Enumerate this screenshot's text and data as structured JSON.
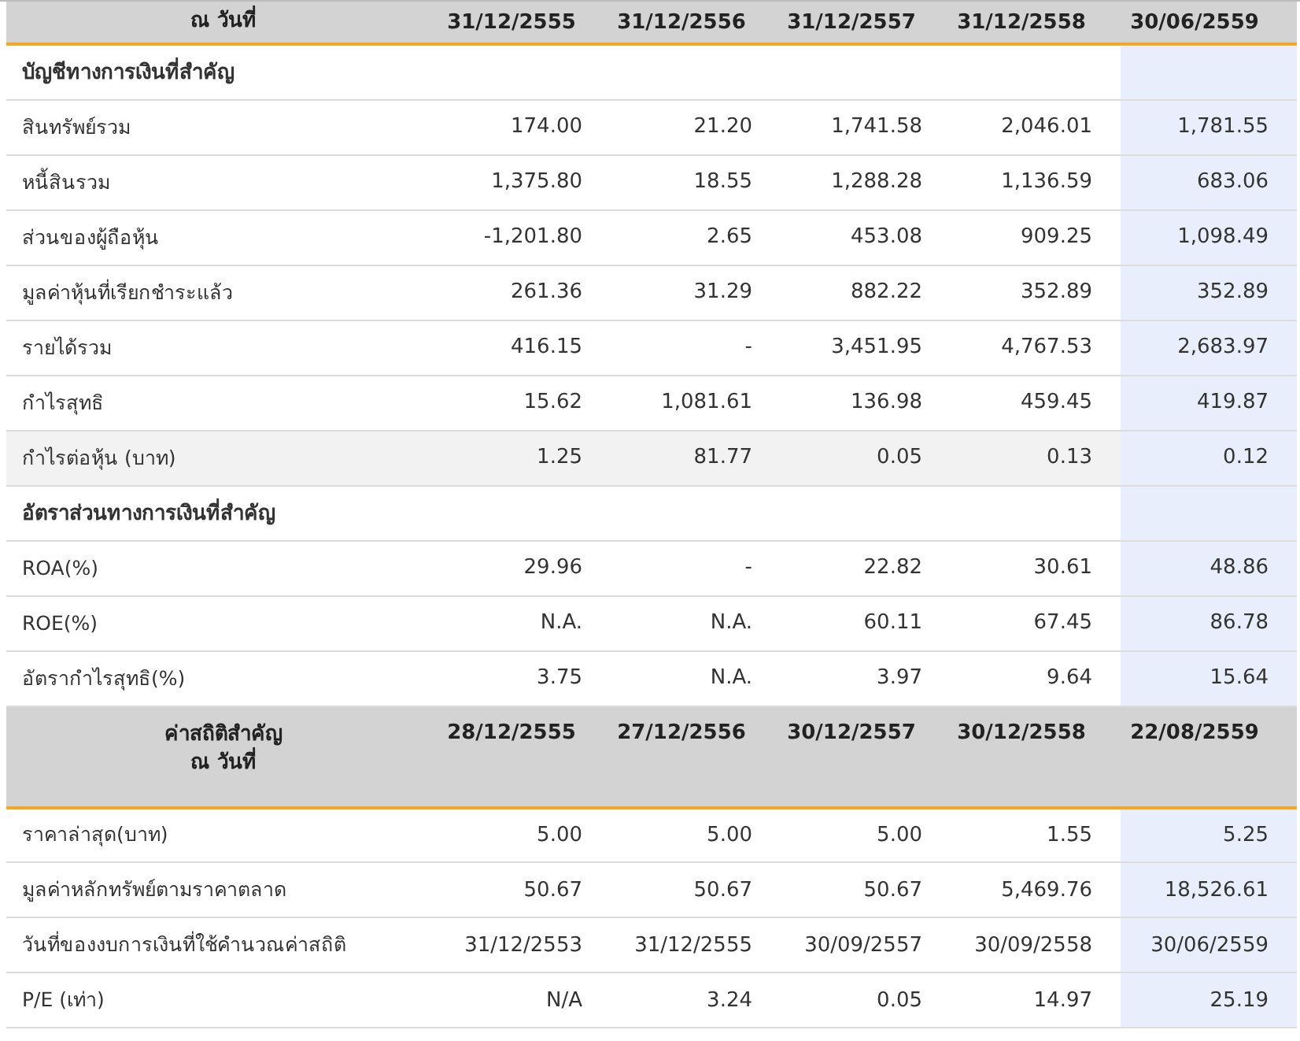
{
  "sections": [
    {
      "header": {
        "label_lines": [
          "ณ วันที่"
        ],
        "columns": [
          {
            "text": "31/12/2555",
            "current": false
          },
          {
            "text": "31/12/2556",
            "current": false
          },
          {
            "text": "31/12/2557",
            "current": false
          },
          {
            "text": "31/12/2558",
            "current": false
          },
          {
            "text": "30/06/2559",
            "current": true
          }
        ]
      },
      "groups": [
        {
          "title": "บัญชีทางการเงินที่สำคัญ",
          "rows": [
            {
              "label": "สินทรัพย์รวม",
              "values": [
                "174.00",
                "21.20",
                "1,741.58",
                "2,046.01",
                "1,781.55"
              ],
              "highlighted": false
            },
            {
              "label": "หนี้สินรวม",
              "values": [
                "1,375.80",
                "18.55",
                "1,288.28",
                "1,136.59",
                "683.06"
              ],
              "highlighted": false
            },
            {
              "label": "ส่วนของผู้ถือหุ้น",
              "values": [
                "-1,201.80",
                "2.65",
                "453.08",
                "909.25",
                "1,098.49"
              ],
              "highlighted": false
            },
            {
              "label": "มูลค่าหุ้นที่เรียกชำระแล้ว",
              "values": [
                "261.36",
                "31.29",
                "882.22",
                "352.89",
                "352.89"
              ],
              "highlighted": false
            },
            {
              "label": "รายได้รวม",
              "values": [
                "416.15",
                "-",
                "3,451.95",
                "4,767.53",
                "2,683.97"
              ],
              "highlighted": false
            },
            {
              "label": "กำไรสุทธิ",
              "values": [
                "15.62",
                "1,081.61",
                "136.98",
                "459.45",
                "419.87"
              ],
              "highlighted": false
            },
            {
              "label": "กำไรต่อหุ้น (บาท)",
              "values": [
                "1.25",
                "81.77",
                "0.05",
                "0.13",
                "0.12"
              ],
              "highlighted": true
            }
          ]
        },
        {
          "title": "อัตราส่วนทางการเงินที่สำคัญ",
          "rows": [
            {
              "label": "ROA(%)",
              "values": [
                "29.96",
                "-",
                "22.82",
                "30.61",
                "48.86"
              ],
              "highlighted": false
            },
            {
              "label": "ROE(%)",
              "values": [
                "N.A.",
                "N.A.",
                "60.11",
                "67.45",
                "86.78"
              ],
              "highlighted": false
            },
            {
              "label": "อัตรากำไรสุทธิ(%)",
              "values": [
                "3.75",
                "N.A.",
                "3.97",
                "9.64",
                "15.64"
              ],
              "highlighted": false
            }
          ]
        }
      ]
    },
    {
      "header": {
        "label_lines": [
          "ค่าสถิติสำคัญ",
          "ณ วันที่"
        ],
        "columns": [
          {
            "text": "28/12/2555",
            "current": false
          },
          {
            "text": "27/12/2556",
            "current": false
          },
          {
            "text": "30/12/2557",
            "current": false
          },
          {
            "text": "30/12/2558",
            "current": false
          },
          {
            "text": "22/08/2559",
            "current": true
          }
        ]
      },
      "groups": [
        {
          "rows": [
            {
              "label": "ราคาล่าสุด(บาท)",
              "values": [
                "5.00",
                "5.00",
                "5.00",
                "1.55",
                "5.25"
              ],
              "highlighted": false
            },
            {
              "label": "มูลค่าหลักทรัพย์ตามราคาตลาด",
              "values": [
                "50.67",
                "50.67",
                "50.67",
                "5,469.76",
                "18,526.61"
              ],
              "highlighted": false
            },
            {
              "label": "วันที่ของงบการเงินที่ใช้คำนวณค่าสถิติ",
              "values": [
                "31/12/2553",
                "31/12/2555",
                "30/09/2557",
                "30/09/2558",
                "30/06/2559"
              ],
              "highlighted": false
            },
            {
              "label": "P/E (เท่า)",
              "values": [
                "N/A",
                "3.24",
                "0.05",
                "14.97",
                "25.19"
              ],
              "highlighted": false
            }
          ]
        }
      ]
    }
  ]
}
